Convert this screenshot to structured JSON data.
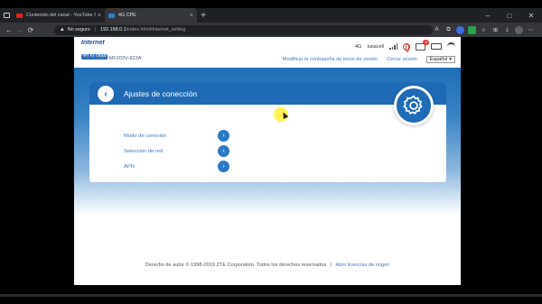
{
  "browser": {
    "tabs": [
      {
        "title": "Contenido del canal - YouTube S",
        "favicon": "youtube-icon"
      },
      {
        "title": "4G CPE",
        "favicon": "cpe-icon"
      }
    ],
    "address": {
      "security_label": "No seguro",
      "host": "192.168.0.1",
      "path": "/index.html#internet_setting"
    }
  },
  "router": {
    "logo": {
      "line1": "Internet",
      "line2": "en tu casa"
    },
    "ssid": "SSID Telcel-MF203V-823A",
    "status": {
      "network": "4G",
      "carrier": "Iusacell",
      "mail_count": "4"
    },
    "links": {
      "change_password": "Modificar la contraseña de inicio de sesión",
      "logout": "Cerrar sesión"
    },
    "language": {
      "selected": "Español"
    },
    "card": {
      "title": "Ajustes de conección",
      "items": [
        {
          "label": "Modo de conexión"
        },
        {
          "label": "Seleccion de red"
        },
        {
          "label": "APN"
        }
      ]
    },
    "footer": {
      "copyright": "Derecho de autor © 1998-2019 ZTE Corporation. Todos los derechos reservados",
      "separator": "|",
      "license_link": "Abrir licencias de origen"
    }
  },
  "colors": {
    "brand_blue": "#1f6ab5",
    "link_blue": "#3d7bbf",
    "chrome_dark": "#202124"
  }
}
